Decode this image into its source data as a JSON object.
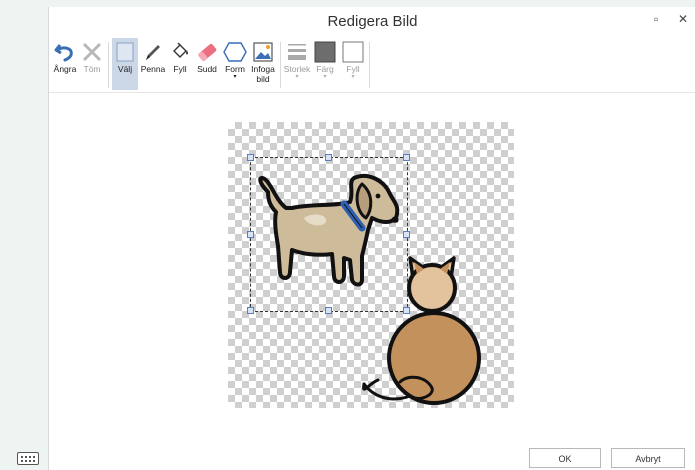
{
  "window": {
    "title": "Redigera Bild",
    "maximize_glyph": "▫",
    "close_glyph": "✕"
  },
  "toolbar": {
    "undo": {
      "label": "Ångra",
      "icon": "undo-icon"
    },
    "clear": {
      "label": "Töm",
      "icon": "clear-icon"
    },
    "select": {
      "label": "Välj",
      "icon": "select-icon"
    },
    "pen": {
      "label": "Penna",
      "icon": "pen-icon"
    },
    "fill": {
      "label": "Fyll",
      "icon": "fill-bucket-icon"
    },
    "eraser": {
      "label": "Sudd",
      "icon": "eraser-icon"
    },
    "shape": {
      "label": "Form",
      "icon": "hexagon-icon"
    },
    "insert_image": {
      "label_line1": "Infoga",
      "label_line2": "bild",
      "icon": "image-icon"
    },
    "size": {
      "label": "Storlek",
      "icon": "line-size-icon"
    },
    "color": {
      "label": "Färg",
      "icon": "color-swatch-icon"
    },
    "fill_color": {
      "label": "Fyll",
      "icon": "fill-swatch-icon"
    },
    "caret": "▾"
  },
  "canvas": {
    "images": [
      "dog-illustration",
      "cat-illustration"
    ],
    "selection": "dog-illustration"
  },
  "footer": {
    "ok_label": "OK",
    "cancel_label": "Avbryt"
  },
  "colors": {
    "undo_blue": "#3a6fb5",
    "selected_tool_bg": "#cbd6e6",
    "dog_body": "#cdbb9a",
    "cat_body": "#c3925c",
    "cat_head": "#e3c29e",
    "collar": "#2f5fb0"
  }
}
